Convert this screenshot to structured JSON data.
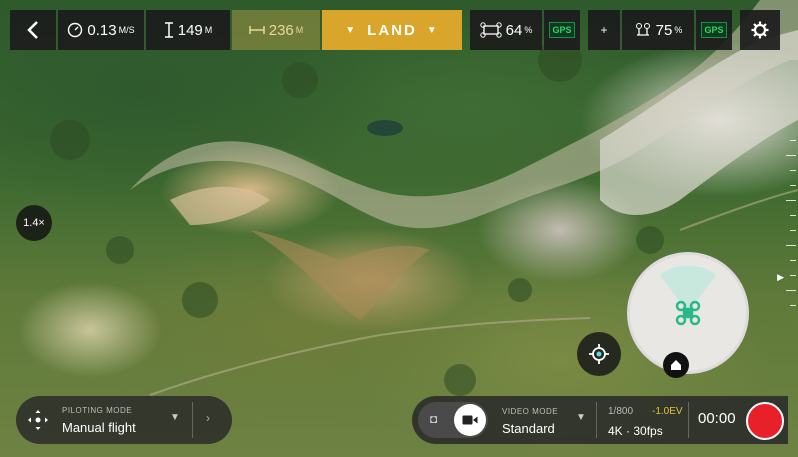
{
  "topbar": {
    "back_icon": "chevron-left-icon",
    "speed": {
      "icon": "speedometer-icon",
      "value": "0.13",
      "unit": "M/S"
    },
    "altitude": {
      "icon": "altitude-icon",
      "value": "149",
      "unit": "M"
    },
    "distance": {
      "icon": "distance-icon",
      "value": "236",
      "unit": "M"
    },
    "land_label": "LAND",
    "drone_battery": {
      "icon": "drone-battery-icon",
      "value": "64",
      "unit": "%"
    },
    "drone_gps": "GPS",
    "plus_icon": "plus-icon",
    "controller_battery": {
      "icon": "controller-battery-icon",
      "value": "75",
      "unit": "%"
    },
    "controller_gps": "GPS",
    "settings_icon": "gear-icon"
  },
  "zoom_level": "1.4×",
  "piloting": {
    "label": "PILOTING MODE",
    "value": "Manual flight"
  },
  "camera": {
    "video_mode_label": "VIDEO MODE",
    "video_mode_value": "Standard",
    "shutter": "1/800",
    "ev": "-1.0EV",
    "resolution": "4K · 30fps",
    "timer": "00:00"
  },
  "colors": {
    "land": "#d9a52a",
    "record": "#e8202a",
    "gps": "#33d16a"
  }
}
